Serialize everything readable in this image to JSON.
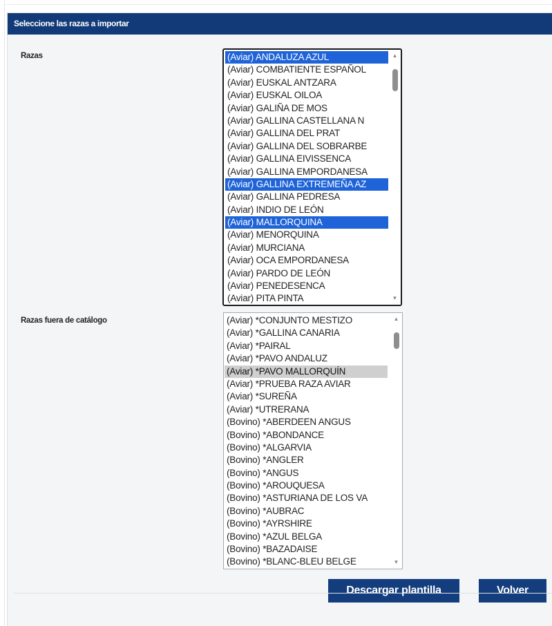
{
  "panel": {
    "title": "Seleccione las razas a importar"
  },
  "razas": {
    "label": "Razas",
    "options": [
      {
        "text": "(Aviar) ANDALUZA AZUL",
        "selected": true
      },
      {
        "text": "(Aviar) COMBATIENTE ESPAÑOL",
        "selected": false
      },
      {
        "text": "(Aviar) EUSKAL ANTZARA",
        "selected": false
      },
      {
        "text": "(Aviar) EUSKAL OILOA",
        "selected": false
      },
      {
        "text": "(Aviar) GALIÑA DE MOS",
        "selected": false
      },
      {
        "text": "(Aviar) GALLINA CASTELLANA N",
        "selected": false
      },
      {
        "text": "(Aviar) GALLINA DEL PRAT",
        "selected": false
      },
      {
        "text": "(Aviar) GALLINA DEL SOBRARBE",
        "selected": false
      },
      {
        "text": "(Aviar) GALLINA EIVISSENCA",
        "selected": false
      },
      {
        "text": "(Aviar) GALLINA EMPORDANESA",
        "selected": false
      },
      {
        "text": "(Aviar) GALLINA EXTREMEÑA AZ",
        "selected": true
      },
      {
        "text": "(Aviar) GALLINA PEDRESA",
        "selected": false
      },
      {
        "text": "(Aviar) INDIO DE LEÓN",
        "selected": false
      },
      {
        "text": "(Aviar) MALLORQUINA",
        "selected": true
      },
      {
        "text": "(Aviar) MENORQUINA",
        "selected": false
      },
      {
        "text": "(Aviar) MURCIANA",
        "selected": false
      },
      {
        "text": "(Aviar) OCA EMPORDANESA",
        "selected": false
      },
      {
        "text": "(Aviar) PARDO DE LEÓN",
        "selected": false
      },
      {
        "text": "(Aviar) PENEDESENCA",
        "selected": false
      },
      {
        "text": "(Aviar) PITA PINTA",
        "selected": false
      }
    ]
  },
  "razas_fuera": {
    "label": "Razas fuera de catálogo",
    "options": [
      {
        "text": "(Aviar) *CONJUNTO MESTIZO",
        "selected": false
      },
      {
        "text": "(Aviar) *GALLINA CANARIA",
        "selected": false
      },
      {
        "text": "(Aviar) *PAIRAL",
        "selected": false
      },
      {
        "text": "(Aviar) *PAVO ANDALUZ",
        "selected": false
      },
      {
        "text": "(Aviar) *PAVO MALLORQUÍN",
        "selected": true
      },
      {
        "text": "(Aviar) *PRUEBA RAZA AVIAR",
        "selected": false
      },
      {
        "text": "(Aviar) *SUREÑA",
        "selected": false
      },
      {
        "text": "(Aviar) *UTRERANA",
        "selected": false
      },
      {
        "text": "(Bovino) *ABERDEEN ANGUS",
        "selected": false
      },
      {
        "text": "(Bovino) *ABONDANCE",
        "selected": false
      },
      {
        "text": "(Bovino) *ALGARVIA",
        "selected": false
      },
      {
        "text": "(Bovino) *ANGLER",
        "selected": false
      },
      {
        "text": "(Bovino) *ANGUS",
        "selected": false
      },
      {
        "text": "(Bovino) *AROUQUESA",
        "selected": false
      },
      {
        "text": "(Bovino) *ASTURIANA DE LOS VA",
        "selected": false
      },
      {
        "text": "(Bovino) *AUBRAC",
        "selected": false
      },
      {
        "text": "(Bovino) *AYRSHIRE",
        "selected": false
      },
      {
        "text": "(Bovino) *AZUL BELGA",
        "selected": false
      },
      {
        "text": "(Bovino) *BAZADAISE",
        "selected": false
      },
      {
        "text": "(Bovino) *BLANC-BLEU BELGE",
        "selected": false
      }
    ]
  },
  "buttons": {
    "download": "Descargar plantilla",
    "back": "Volver"
  },
  "icons": {
    "scroll_up": "scroll-up-arrow-icon",
    "scroll_down": "scroll-down-arrow-icon"
  },
  "colors": {
    "header_bg": "#123a78",
    "button_bg": "#133d7d",
    "selection_blue": "#1e63d8",
    "selection_grey": "#cfcfcf"
  }
}
